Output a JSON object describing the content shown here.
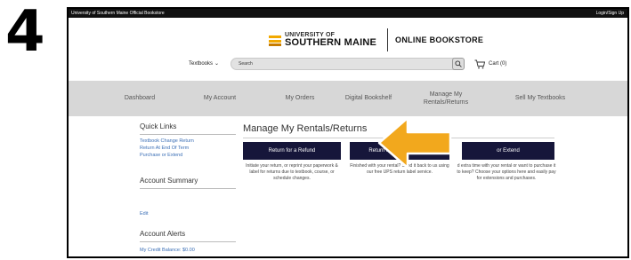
{
  "step_number": "4",
  "topbar": {
    "site_title": "University of Southern Maine Official Bookstore",
    "login": "Login/Sign Up"
  },
  "header": {
    "university_top": "UNIVERSITY OF",
    "university_bottom": "SOUTHERN MAINE",
    "store_name": "ONLINE BOOKSTORE"
  },
  "search": {
    "category": "Textbooks",
    "placeholder": "Search",
    "cart_label": "Cart (0)"
  },
  "nav": {
    "items": [
      {
        "label": "Dashboard"
      },
      {
        "label": "My Account"
      },
      {
        "label": "My Orders"
      },
      {
        "label": "Digital Bookshelf"
      },
      {
        "label": "Manage My Rentals/Returns"
      },
      {
        "label": "Sell My Textbooks"
      }
    ]
  },
  "sidebar": {
    "quick_links_heading": "Quick Links",
    "quick_links": [
      "Textbook Change Return",
      "Return At End Of Term",
      "Purchase or Extend"
    ],
    "account_summary_heading": "Account Summary",
    "edit_link": "Edit",
    "account_alerts_heading": "Account Alerts",
    "credit_balance": "My Credit Balance: $0.00"
  },
  "main": {
    "title": "Manage My Rentals/Returns",
    "actions": [
      {
        "button": "Return for a Refund",
        "description": "Initiate your return, or reprint your paperwork & label for returns due to textbook, course, or schedule changes."
      },
      {
        "button": "Return my Rental for Free",
        "description": "Finished with your rental? Send it back to us using our free UPS return label service."
      },
      {
        "button": "or Extend",
        "description": "d extra time with your rental or want to purchase it to keep? Choose your options here and easily pay for extensions and purchases."
      }
    ]
  },
  "colors": {
    "button_bg": "#16163a",
    "nav_bg": "#d7d7d7",
    "arrow_fill": "#f2a81d",
    "link": "#3b6fb6"
  },
  "annotation": {
    "arrow_icon": "callout-arrow-left"
  }
}
